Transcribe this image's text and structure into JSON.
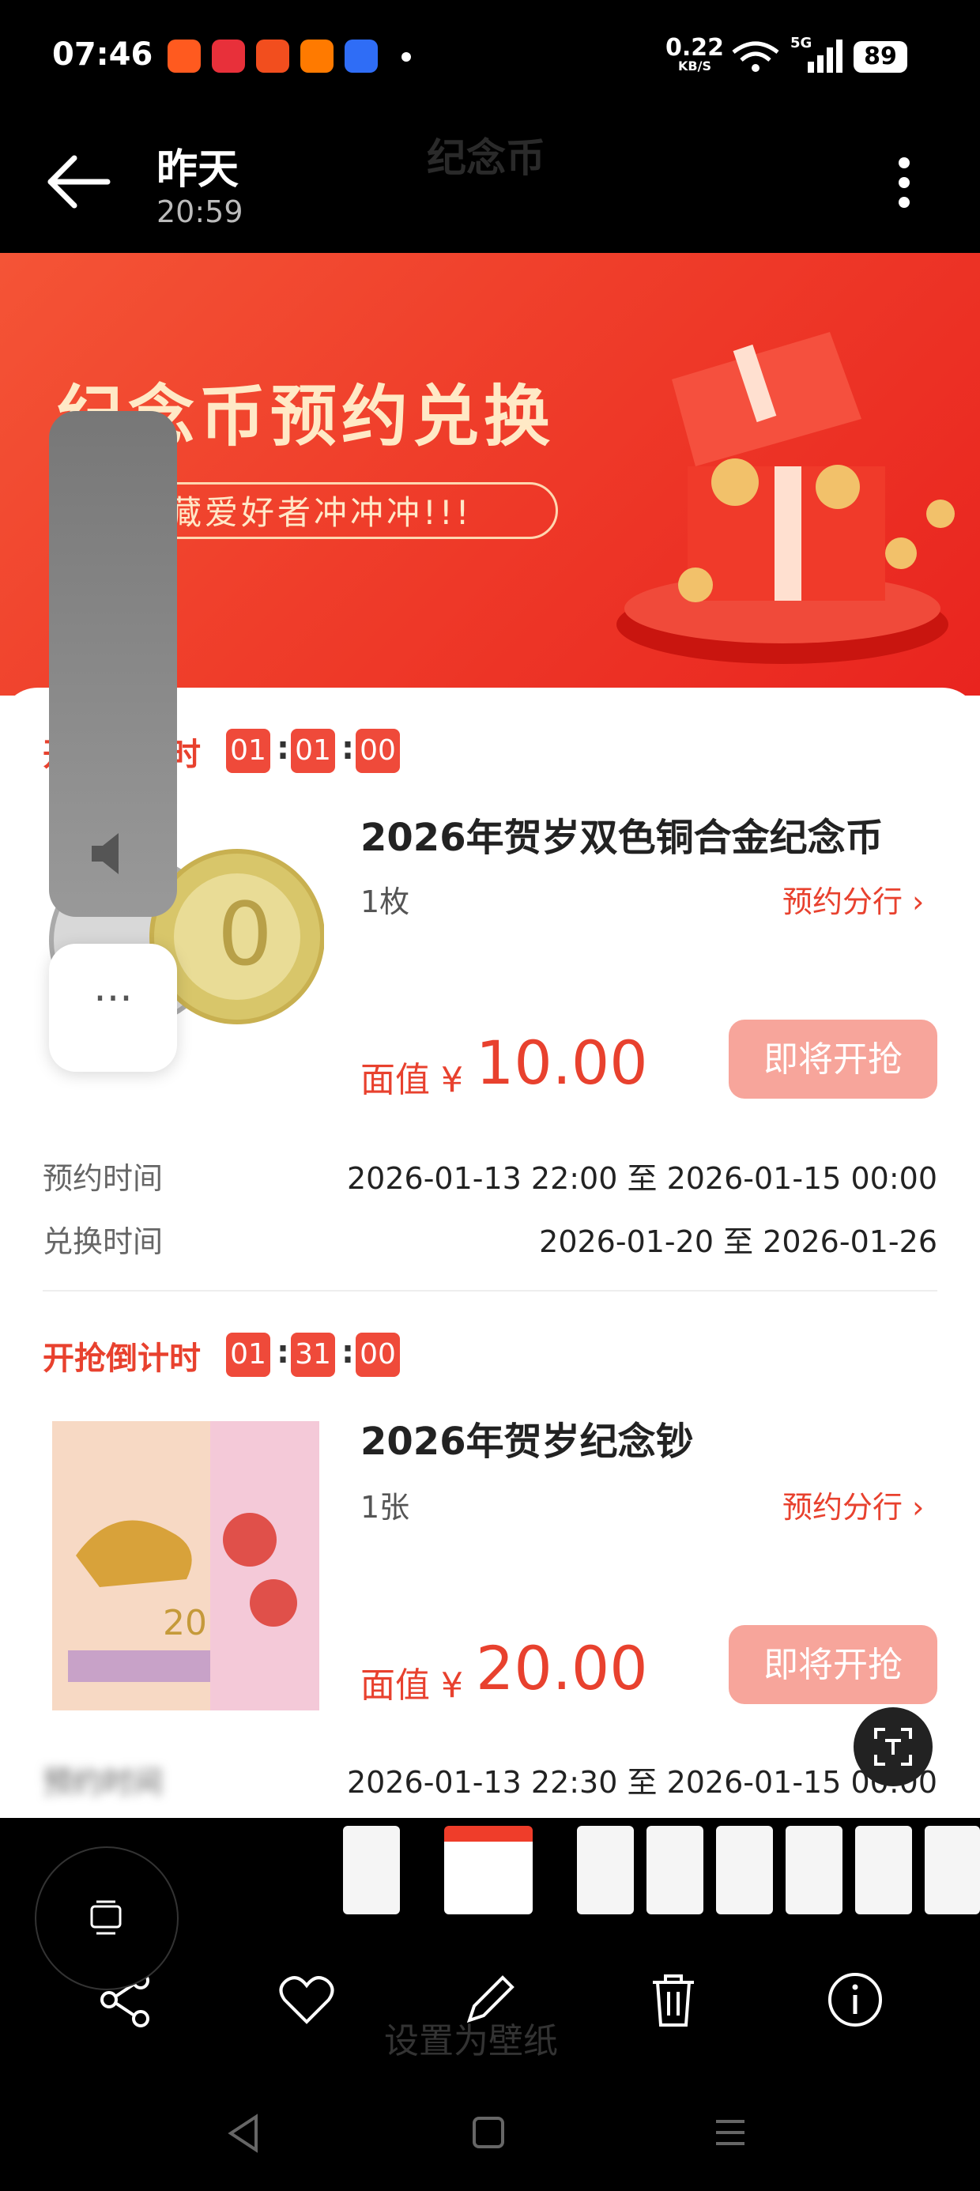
{
  "status_bar": {
    "time": "07:46",
    "net_speed": "0.22",
    "net_unit": "KB/S",
    "signal": "5G",
    "battery": "89",
    "icons": [
      "weibo-icon",
      "app-icon",
      "taobao-icon",
      "gift-icon",
      "baidu-icon",
      "dot-icon",
      "wifi-icon",
      "signal-icon",
      "battery-icon"
    ]
  },
  "viewer": {
    "title": "昨天",
    "time": "20:59",
    "ghost_title": "纪念币",
    "ghost_bottom": "设置为壁纸"
  },
  "banner": {
    "title": "纪念币预约兑换",
    "subtitle": "藏爱好者冲冲冲!!!"
  },
  "products": [
    {
      "countdown_label": "开抢倒计时",
      "countdown": [
        "01",
        "01",
        "00"
      ],
      "title": "2026年贺岁双色铜合金纪念币",
      "qty": "1枚",
      "branch": "预约分行",
      "price_label": "面值 ¥",
      "price": "10.00",
      "button": "即将开抢",
      "rows": [
        {
          "label": "预约时间",
          "value": "2026-01-13 22:00 至 2026-01-15 00:00"
        },
        {
          "label": "兑换时间",
          "value": "2026-01-20 至 2026-01-26"
        }
      ]
    },
    {
      "countdown_label": "开抢倒计时",
      "countdown": [
        "01",
        "31",
        "00"
      ],
      "title": "2026年贺岁纪念钞",
      "qty": "1张",
      "branch": "预约分行",
      "price_label": "面值 ¥",
      "price": "20.00",
      "button": "即将开抢",
      "rows": [
        {
          "label": "预约时间",
          "value": "2026-01-13 22:30 至 2026-01-15 00:00"
        }
      ]
    }
  ],
  "colors": {
    "accent": "#e8412e",
    "button": "#f7a59b",
    "banner": "#ef3d2a"
  }
}
